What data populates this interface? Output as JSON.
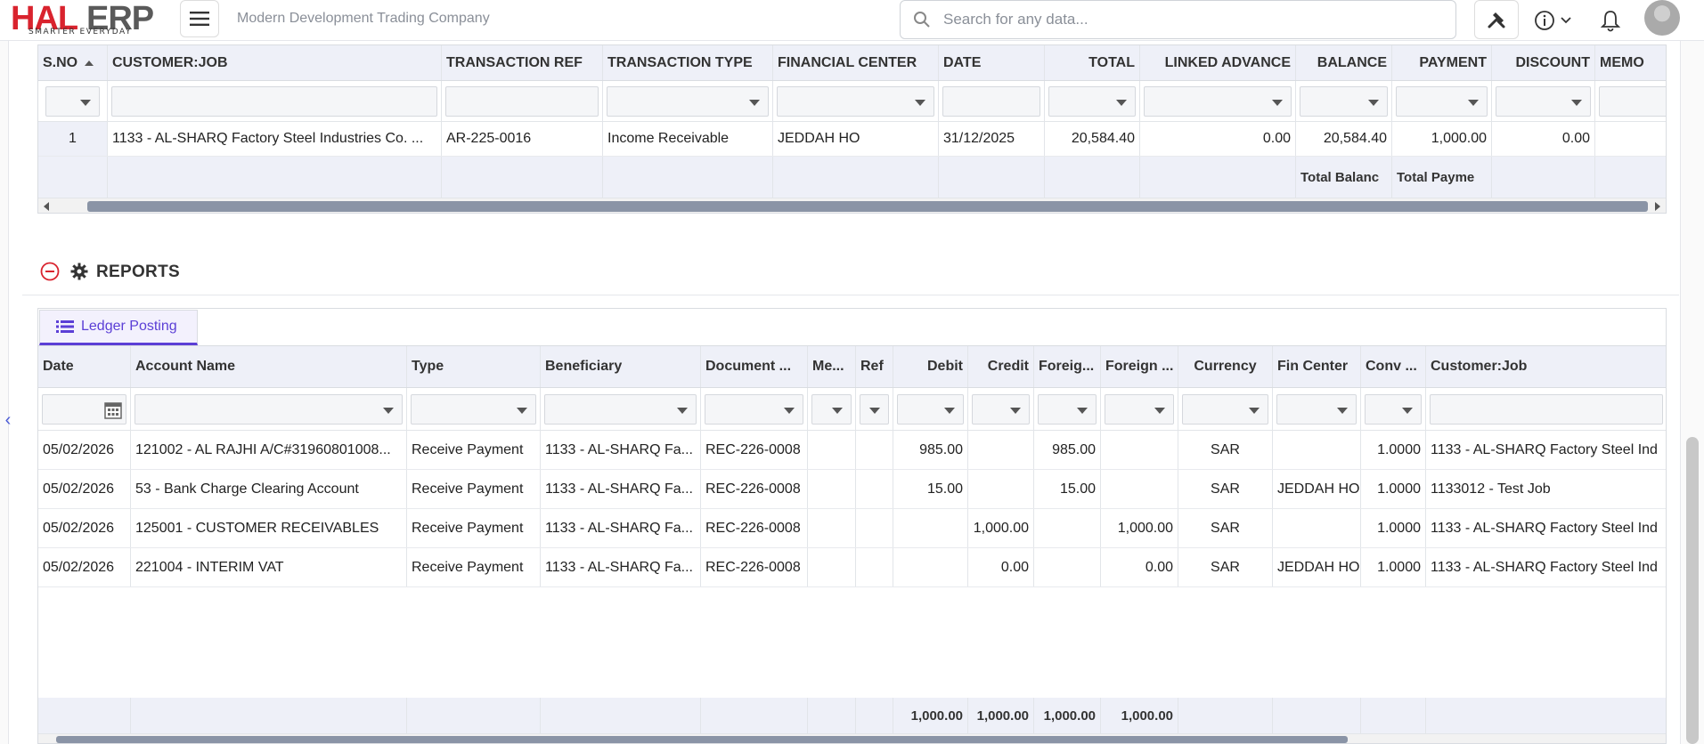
{
  "logo": {
    "part1": "HAL",
    "part2": "ERP",
    "tagline": "SMARTER EVERYDAY"
  },
  "header": {
    "company": "Modern Development Trading Company",
    "search_placeholder": "Search for any data..."
  },
  "colors": {
    "accent": "#5b3fd6",
    "brand_red": "#d9232e",
    "header_bg": "#eef0f8",
    "collapse_red": "#d9232e"
  },
  "icons": {
    "menu": "hamburger-icon",
    "search": "search-icon",
    "tools": "tools-icon",
    "info": "info-icon",
    "bell": "bell-icon",
    "collapse": "minus-circle-icon",
    "gear": "gear-icon",
    "list": "list-icon",
    "calendar": "calendar-icon"
  },
  "top_grid": {
    "columns": [
      "S.NO",
      "CUSTOMER:JOB",
      "TRANSACTION REF",
      "TRANSACTION TYPE",
      "FINANCIAL CENTER",
      "DATE",
      "TOTAL",
      "LINKED ADVANCE",
      "BALANCE",
      "PAYMENT",
      "DISCOUNT",
      "MEMO"
    ],
    "sort_column": "S.NO",
    "rows": [
      [
        "1",
        "1133 - AL-SHARQ Factory Steel Industries Co. ...",
        "AR-225-0016",
        "Income Receivable",
        "JEDDAH HO",
        "31/12/2025",
        "20,584.40",
        "0.00",
        "20,584.40",
        "1,000.00",
        "0.00",
        ""
      ]
    ],
    "summary": {
      "balance": "Total Balanc",
      "payment": "Total Payme"
    }
  },
  "reports": {
    "title": "REPORTS",
    "tab_label": "Ledger Posting",
    "ledger": {
      "columns": [
        "Date",
        "Account Name",
        "Type",
        "Beneficiary",
        "Document ...",
        "Me...",
        "Ref",
        "Debit",
        "Credit",
        "Foreig...",
        "Foreign ...",
        "Currency",
        "Fin Center",
        "Conv ...",
        "Customer:Job"
      ],
      "rows": [
        [
          "05/02/2026",
          "121002 - AL RAJHI A/C#31960801008...",
          "Receive Payment",
          "1133 - AL-SHARQ Fa...",
          "REC-226-0008",
          "",
          "",
          "985.00",
          "",
          "985.00",
          "",
          "SAR",
          "",
          "1.0000",
          "1133 - AL-SHARQ Factory Steel Ind"
        ],
        [
          "05/02/2026",
          "53 - Bank Charge Clearing Account",
          "Receive Payment",
          "1133 - AL-SHARQ Fa...",
          "REC-226-0008",
          "",
          "",
          "15.00",
          "",
          "15.00",
          "",
          "SAR",
          "JEDDAH HO",
          "1.0000",
          "1133012 - Test Job"
        ],
        [
          "05/02/2026",
          "125001 - CUSTOMER RECEIVABLES",
          "Receive Payment",
          "1133 - AL-SHARQ Fa...",
          "REC-226-0008",
          "",
          "",
          "",
          "1,000.00",
          "",
          "1,000.00",
          "SAR",
          "",
          "1.0000",
          "1133 - AL-SHARQ Factory Steel Ind"
        ],
        [
          "05/02/2026",
          "221004 - INTERIM VAT",
          "Receive Payment",
          "1133 - AL-SHARQ Fa...",
          "REC-226-0008",
          "",
          "",
          "",
          "0.00",
          "",
          "0.00",
          "SAR",
          "JEDDAH HO",
          "1.0000",
          "1133 - AL-SHARQ Factory Steel Ind"
        ]
      ],
      "totals": {
        "debit": "1,000.00",
        "credit": "1,000.00",
        "foreign_debit": "1,000.00",
        "foreign_credit": "1,000.00"
      }
    }
  }
}
